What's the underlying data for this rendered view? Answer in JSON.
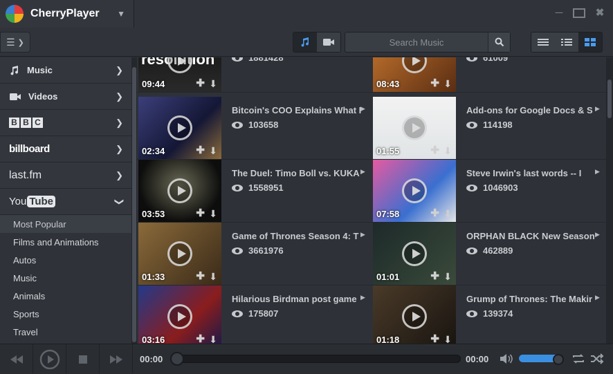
{
  "app": {
    "title": "CherryPlayer"
  },
  "toolbar": {
    "search_placeholder": "Search Music",
    "mode_music_active": true,
    "view_mode_active": "grid"
  },
  "sidebar": {
    "sources": [
      {
        "label": "Music",
        "icon": "music-note-icon"
      },
      {
        "label": "Videos",
        "icon": "video-camera-icon"
      },
      {
        "label": "BBC",
        "icon": "bbc-logo"
      },
      {
        "label": "billboard",
        "icon": "billboard-logo"
      },
      {
        "label": "last.fm",
        "icon": "lastfm-logo"
      },
      {
        "label": "YouTube",
        "icon": "youtube-logo",
        "expanded": true
      }
    ],
    "categories": [
      "Most Popular",
      "Films and Animations",
      "Autos",
      "Music",
      "Animals",
      "Sports",
      "Travel"
    ],
    "selected_category": "Most Popular"
  },
  "videos": [
    {
      "title": "",
      "views": "1881428",
      "duration": "09:44"
    },
    {
      "title": "",
      "views": "61009",
      "duration": "08:43"
    },
    {
      "title": "Bitcoin's COO Explains What I",
      "views": "103658",
      "duration": "02:34"
    },
    {
      "title": "Add-ons for Google Docs & S",
      "views": "114198",
      "duration": "01:55"
    },
    {
      "title": "The Duel: Timo Boll vs. KUKA",
      "views": "1558951",
      "duration": "03:53"
    },
    {
      "title": "Steve Irwin's last words -- I",
      "views": "1046903",
      "duration": "07:58"
    },
    {
      "title": "Game of Thrones Season 4: T",
      "views": "3661976",
      "duration": "01:33"
    },
    {
      "title": "ORPHAN BLACK New Season",
      "views": "462889",
      "duration": "01:01"
    },
    {
      "title": "Hilarious Birdman post game",
      "views": "175807",
      "duration": "03:16"
    },
    {
      "title": "Grump of Thrones: The Makir",
      "views": "139374",
      "duration": "01:18"
    }
  ],
  "thumb_overlay_text": "special resolution",
  "player": {
    "current_time": "00:00",
    "total_time": "00:00",
    "volume": 0.9,
    "progress": 0
  }
}
